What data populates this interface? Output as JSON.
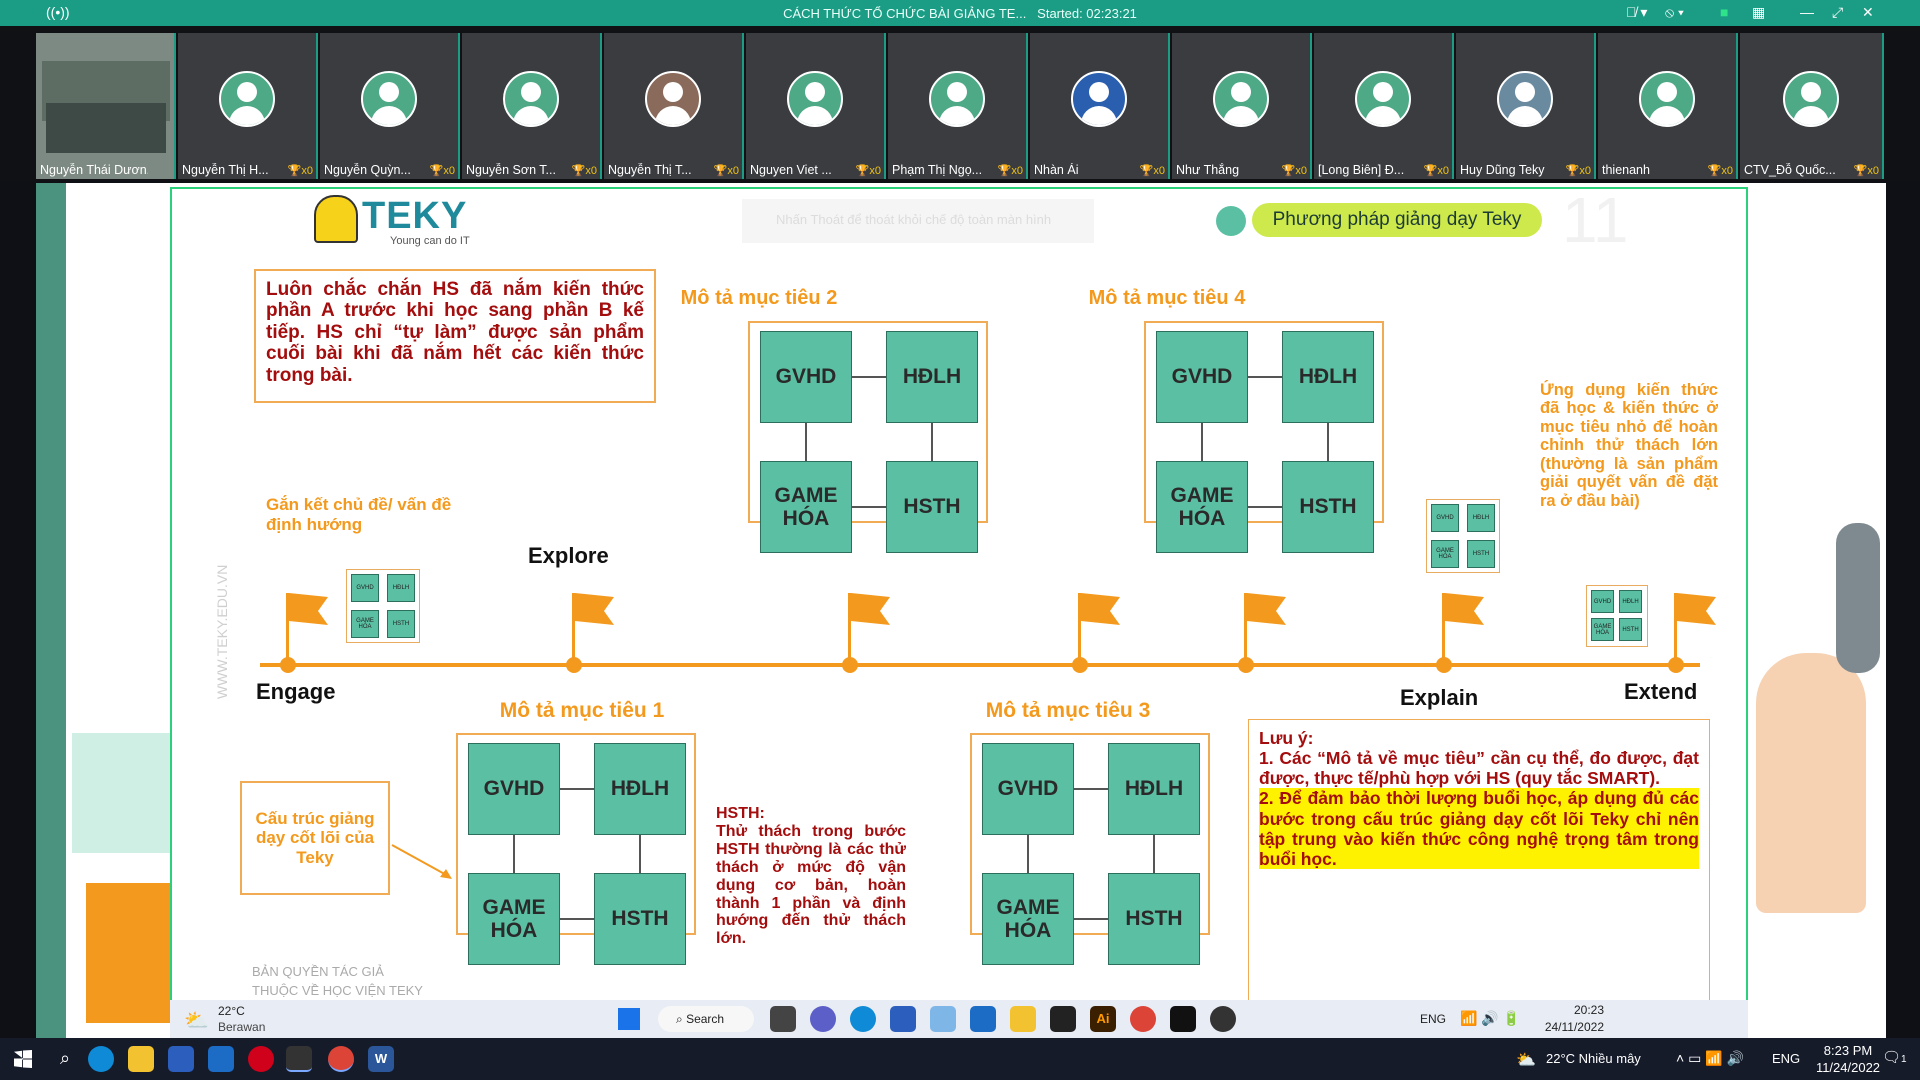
{
  "zoom_window": {
    "title": "CÁCH THỨC TỔ CHỨC BÀI GIẢNG TE...",
    "started": "Started: 02:23:21"
  },
  "participants": [
    {
      "name": "Nguyễn Thái Dươn...",
      "count": ""
    },
    {
      "name": "Nguyễn Thị H...",
      "count": "x0"
    },
    {
      "name": "Nguyễn Quỳn...",
      "count": "x0"
    },
    {
      "name": "Nguyễn Sơn T...",
      "count": "x0"
    },
    {
      "name": "Nguyễn Thị T...",
      "count": "x0"
    },
    {
      "name": "Nguyen Viet ...",
      "count": "x0"
    },
    {
      "name": "Phạm Thị Ngọ...",
      "count": "x0"
    },
    {
      "name": "Nhàn Ái",
      "count": "x0"
    },
    {
      "name": "Như Thắng",
      "count": "x0"
    },
    {
      "name": "[Long Biên] Đ...",
      "count": "x0"
    },
    {
      "name": "Huy Dũng Teky",
      "count": "x0"
    },
    {
      "name": "thienanh",
      "count": "x0"
    },
    {
      "name": "CTV_Đỗ Quốc...",
      "count": "x0"
    }
  ],
  "slide": {
    "logo": "TEKY",
    "logo_tagline": "Young can do IT",
    "faded_toolbar": "Nhấn   Thoát   để thoát khỏi chế độ toàn màn hình",
    "header_pill": "Phương pháp giảng dạy Teky",
    "page_number": "11",
    "note_top": "Luôn chắc chắn HS đã nắm kiến thức phần A trước khi học sang phần B kế tiếp. HS chỉ “tự làm” được sản phẩm cuối bài khi đã nắm hết các kiến thức trong bài.",
    "engage_note": "Gắn kết chủ đề/ vấn đề định hướng",
    "explain_note": "Ứng dụng kiến thức đã học & kiến thức ở mục tiêu nhỏ để hoàn chỉnh thử thách lớn (thường là sản phẩm giải quyết vấn đề đặt ra ở đầu bài)",
    "watermark": "WWW.TEKY.EDU.VN",
    "stages": {
      "engage": "Engage",
      "explore": "Explore",
      "explain": "Explain",
      "extend": "Extend"
    },
    "goals": [
      "Mô tả mục tiêu 1",
      "Mô tả mục tiêu 2",
      "Mô tả mục tiêu 3",
      "Mô tả mục tiêu 4"
    ],
    "cells": {
      "gvhd": "GVHD",
      "hdlh": "HĐLH",
      "game": "GAME HÓA",
      "hsth": "HSTH"
    },
    "mini_cells": {
      "gvhd": "GVHD",
      "hdlh": "HĐLH",
      "game": "GAME HÓA",
      "hsth": "HSTH"
    },
    "structure_label": "Cấu trúc giảng dạy cốt lõi của Teky",
    "hsth_title": "HSTH:",
    "hsth_body": "Thử thách trong bước HSTH thường là các thử thách ở mức độ vận dụng cơ bản, hoàn thành 1 phần và định hướng đến thử thách lớn.",
    "notes_title": "Lưu ý:",
    "notes_1": "1. Các “Mô tả về mục tiêu” cần cụ thể, đo được, đạt được, thực tế/phù hợp với HS (quy tắc SMART).",
    "notes_2": "2. Để đảm bảo thời lượng buổi học, áp dụng đủ các bước trong cấu trúc giảng dạy cốt lõi Teky chỉ nên tập trung vào kiến thức công nghệ trọng tâm trong buổi học.",
    "copyright_1": "BẢN QUYỀN TÁC GIẢ",
    "copyright_2": "THUỘC VỀ HỌC VIỆN TEKY"
  },
  "inner_taskbar": {
    "weather_temp": "22°C",
    "weather_desc": "Berawan",
    "search": "Search",
    "lang": "ENG",
    "time": "20:23",
    "date": "24/11/2022"
  },
  "outer_taskbar": {
    "weather": "22°C  Nhiều mây",
    "lang": "ENG",
    "time": "8:23 PM",
    "date": "11/24/2022",
    "notif_count": "1"
  },
  "colors": {
    "teal": "#1b9c85",
    "orange": "#f39a1e",
    "dark_red": "#a40d0d",
    "green_cell": "#5bc0a3",
    "highlight": "#fff200"
  }
}
